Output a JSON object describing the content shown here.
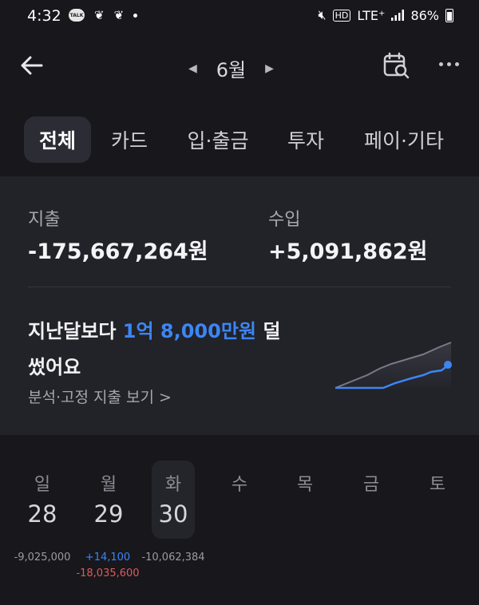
{
  "status_bar": {
    "time": "4:32",
    "talk_badge": "TALK",
    "network": "LTE⁺",
    "hd_badge": "HD",
    "battery": "86%"
  },
  "header": {
    "month": "6월"
  },
  "tabs": [
    {
      "label": "전체",
      "active": true
    },
    {
      "label": "카드",
      "active": false
    },
    {
      "label": "입·출금",
      "active": false
    },
    {
      "label": "투자",
      "active": false
    },
    {
      "label": "페이·기타",
      "active": false
    }
  ],
  "summary": {
    "expense_label": "지출",
    "expense_value": "-175,667,264원",
    "income_label": "수입",
    "income_value": "+5,091,862원",
    "compare_prefix": "지난달보다 ",
    "compare_amount": "1억 8,000만원",
    "compare_suffix_1": " 덜",
    "compare_suffix_2": "썼어요",
    "analysis_link": "분석·고정 지출 보기 >"
  },
  "calendar": {
    "weekdays": [
      "일",
      "월",
      "화",
      "수",
      "목",
      "금",
      "토"
    ],
    "days": [
      {
        "date": "28",
        "expense": "-9,025,000"
      },
      {
        "date": "29",
        "income": "+14,100",
        "expense": "-18,035,600"
      },
      {
        "date": "30",
        "expense": "-10,062,384"
      }
    ]
  },
  "colors": {
    "accent_blue": "#3c86f3",
    "expense_red": "#e05a5a",
    "background": "#17171c",
    "card": "#222229"
  },
  "icons": {
    "back": "arrow-left-icon",
    "prev_month": "triangle-left-icon",
    "next_month": "triangle-right-icon",
    "calendar_search": "calendar-search-icon",
    "more": "more-horizontal-icon"
  }
}
